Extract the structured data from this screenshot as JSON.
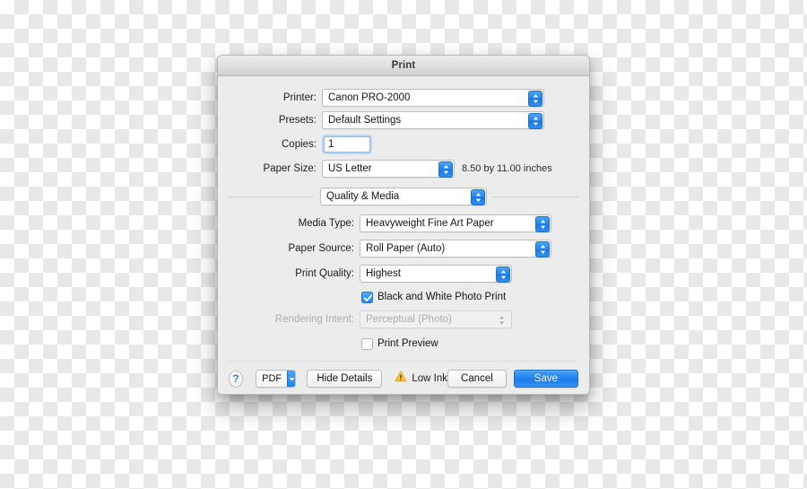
{
  "window": {
    "title": "Print"
  },
  "fields": {
    "printer": {
      "label": "Printer:",
      "value": "Canon PRO-2000"
    },
    "presets": {
      "label": "Presets:",
      "value": "Default Settings"
    },
    "copies": {
      "label": "Copies:",
      "value": "1",
      "placeholder": "1"
    },
    "paper_size": {
      "label": "Paper Size:",
      "value": "US Letter",
      "dimensions": "8.50 by 11.00 inches"
    },
    "pane": {
      "value": "Quality & Media"
    },
    "media_type": {
      "label": "Media Type:",
      "value": "Heavyweight Fine Art Paper"
    },
    "paper_source": {
      "label": "Paper Source:",
      "value": "Roll Paper (Auto)"
    },
    "print_quality": {
      "label": "Print Quality:",
      "value": "Highest"
    },
    "bw_photo": {
      "label": "Black and White Photo Print",
      "checked": true
    },
    "rendering_intent": {
      "label": "Rendering Intent:",
      "value": "Perceptual (Photo)",
      "enabled": false
    },
    "print_preview": {
      "label": "Print Preview",
      "checked": false
    }
  },
  "buttons": {
    "help": "?",
    "pdf": "PDF",
    "hide_details": "Hide Details",
    "cancel": "Cancel",
    "save": "Save"
  },
  "status": {
    "low_ink": "Low Ink"
  },
  "colors": {
    "accent_blue": "#1f82ef",
    "warning_amber": "#f5c13b",
    "dialog_bg": "#ececec",
    "focus_ring": "#b6d8f7"
  }
}
